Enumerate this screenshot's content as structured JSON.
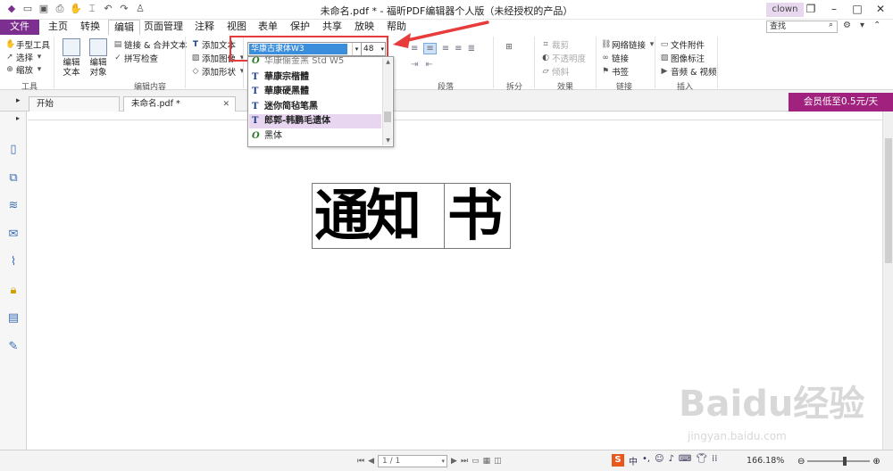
{
  "app": {
    "title": "未命名.pdf * - 福昕PDF编辑器个人版（未经授权的产品）",
    "user": "clown"
  },
  "menu": {
    "file": "文件",
    "tabs": [
      "主页",
      "转换",
      "编辑",
      "页面管理",
      "注释",
      "视图",
      "表单",
      "保护",
      "共享",
      "放映",
      "帮助"
    ],
    "active_tab": "编辑",
    "search_placeholder": "查找"
  },
  "ribbon": {
    "tools": {
      "hand": "手型工具",
      "select": "选择",
      "zoom": "缩放",
      "label": "工具"
    },
    "edit_content": {
      "edit_text": "编辑文本",
      "edit_object": "编辑对象",
      "link_merge": "链接 & 合并文本",
      "spell_check": "拼写检查",
      "label": "编辑内容"
    },
    "add": {
      "add_text": "添加文本",
      "add_image": "添加图像",
      "add_shape": "添加形状"
    },
    "font": {
      "current": "华康古隶体W3",
      "size": "48"
    },
    "paragraph": {
      "label": "段落"
    },
    "split": {
      "label": "拆分"
    },
    "effects": {
      "crop": "裁剪",
      "opacity": "不透明度",
      "skew": "倾斜",
      "label": "效果"
    },
    "links": {
      "web_link": "网络链接",
      "link": "链接",
      "bookmark": "书签",
      "label": "链接"
    },
    "insert": {
      "file_attachment": "文件附件",
      "image_annotation": "图像标注",
      "audio_video": "音频 & 视频",
      "label": "插入"
    }
  },
  "font_list": [
    {
      "type": "O",
      "name": "华康俪金黑 Std W5"
    },
    {
      "type": "T",
      "name": "華康宗楷體"
    },
    {
      "type": "T",
      "name": "華康硬黑體"
    },
    {
      "type": "T",
      "name": "迷你简毡笔黑"
    },
    {
      "type": "T",
      "name": "郎郭-韩鹏毛遗体",
      "selected": true
    },
    {
      "type": "O",
      "name": "黑体"
    }
  ],
  "doc_tabs": {
    "start": "开始",
    "file": "未命名.pdf *"
  },
  "vip_banner": "会员低至0.5元/天",
  "document": {
    "text_box1": "通知",
    "text_box2": "书"
  },
  "status": {
    "page": "1 / 1",
    "zoom": "166.18%"
  },
  "watermark": {
    "logo": "Baidu经验",
    "url": "jingyan.baidu.com"
  },
  "colors": {
    "file_tab": "#7c2f8f",
    "vip": "#a0227e",
    "highlight_box": "#e83b3b",
    "selection": "#3b8edb"
  }
}
